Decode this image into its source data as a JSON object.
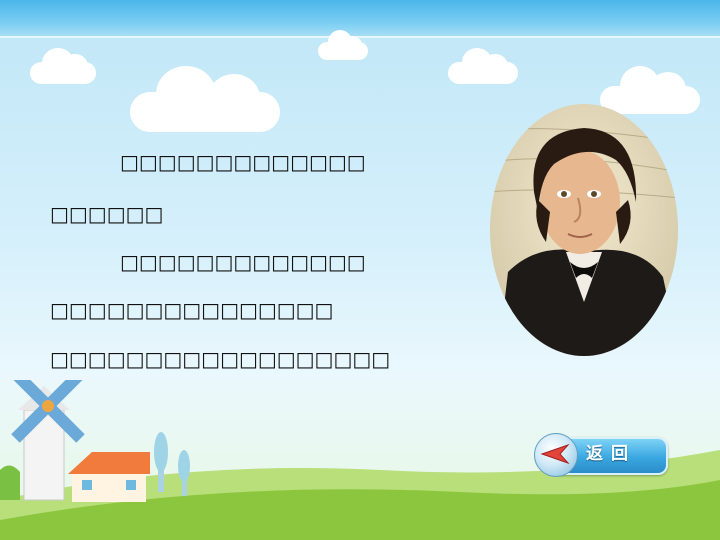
{
  "body_text": {
    "line1": "□□□□□□□□□□□□□",
    "line2": "□□□□□□",
    "line3": "□□□□□□□□□□□□□",
    "line4": "□□□□□□□□□□□□□□□",
    "line5": "□□□□□□□□□□□□□□□□□□"
  },
  "nav": {
    "back_label": "返回"
  },
  "colors": {
    "top_bar": "#4bb6ea",
    "sky": "#d6f0fb",
    "grass": "#8cc63f",
    "button": "#3aa7e0"
  },
  "icons": {
    "back": "left-arrow-icon"
  }
}
